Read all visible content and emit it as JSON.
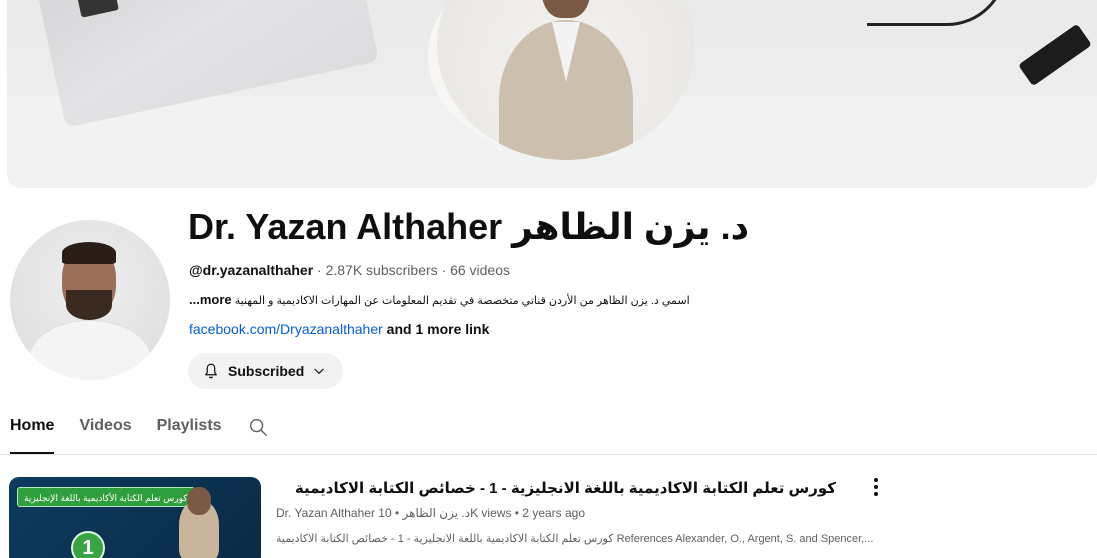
{
  "channel": {
    "name": "Dr. Yazan Althaher د. يزن الظاهر",
    "handle": "@dr.yazanalthaher",
    "stats": " · 2.87K subscribers · 66 videos",
    "description": "اسمي د. يزن الظاهر من الأردن قناتي متخصصة في تقديم المعلومات عن المهارات الاكاديمية و المهنية",
    "description_more": "...more",
    "link": "facebook.com/Dryazanalthaher",
    "more_links": " and 1 more link",
    "subscribe_label": "Subscribed"
  },
  "tabs": [
    {
      "label": "Home",
      "active": true
    },
    {
      "label": "Videos",
      "active": false
    },
    {
      "label": "Playlists",
      "active": false
    }
  ],
  "featured_video": {
    "title": "كورس تعلم الكتابة الاكاديمية باللغة الانجليزية - 1 - خصائص الكتابة الاكاديمية",
    "meta": "Dr. Yazan Althaher د. يزن الظاهر • 10K views • 2 years ago",
    "description": "كورس تعلم الكتابة الاكاديمية باللغة الانجليزية - 1 - خصائص الكتابة الاكاديمية References Alexander, O., Argent, S. and Spencer,...",
    "thumb_tag": "كورس تعلم الكتابة الأكاديمية باللغة الإنجليزية",
    "thumb_number": "1"
  },
  "icons": {
    "bell": "bell-icon",
    "chevron": "chevron-down-icon",
    "search": "search-icon",
    "more": "more-vert-icon"
  },
  "colors": {
    "link": "#065fd4",
    "button_bg": "#f2f2f2",
    "thumb_accent": "#2f9e3c"
  }
}
